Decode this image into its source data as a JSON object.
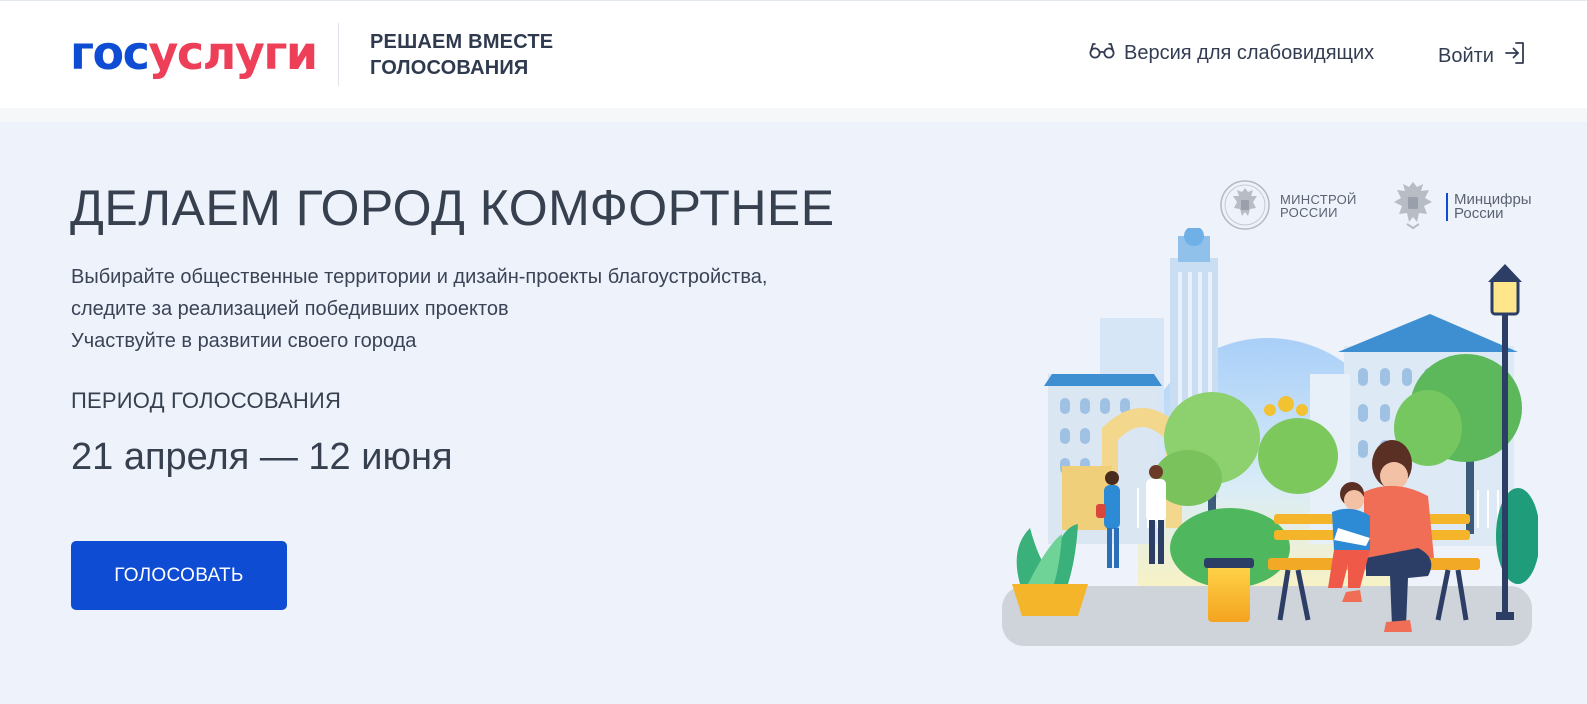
{
  "header": {
    "logo": {
      "part1": "гос",
      "part2": "услуги"
    },
    "tagline_line1": "РЕШАЕМ ВМЕСТЕ",
    "tagline_line2": "ГОЛОСОВАНИЯ",
    "accessibility_label": "Версия для слабовидящих",
    "login_label": "Войти"
  },
  "hero": {
    "title": "ДЕЛАЕМ ГОРОД КОМФОРТНЕЕ",
    "description_line1": "Выбирайте общественные территории и дизайн-проекты благоустройства,",
    "description_line2": "следите за реализацией победивших проектов",
    "description_line3": "Участвуйте в развитии своего города",
    "period_label": "ПЕРИОД ГОЛОСОВАНИЯ",
    "period_dates": "21 апреля — 12 июня",
    "vote_button": "ГОЛОСОВАТЬ"
  },
  "partners": [
    {
      "line1": "МИНСТРОЙ",
      "line2": "РОССИИ",
      "icon": "coat-of-arms-icon"
    },
    {
      "line1": "Минцифры",
      "line2": "России",
      "icon": "coat-of-arms-icon"
    }
  ],
  "colors": {
    "brand_blue": "#0d4cd3",
    "brand_red": "#ee3f58",
    "page_bg": "#eef2fb",
    "text_dark": "#36404f"
  },
  "icons": {
    "accessibility": "glasses-icon",
    "login": "login-arrow-icon"
  }
}
